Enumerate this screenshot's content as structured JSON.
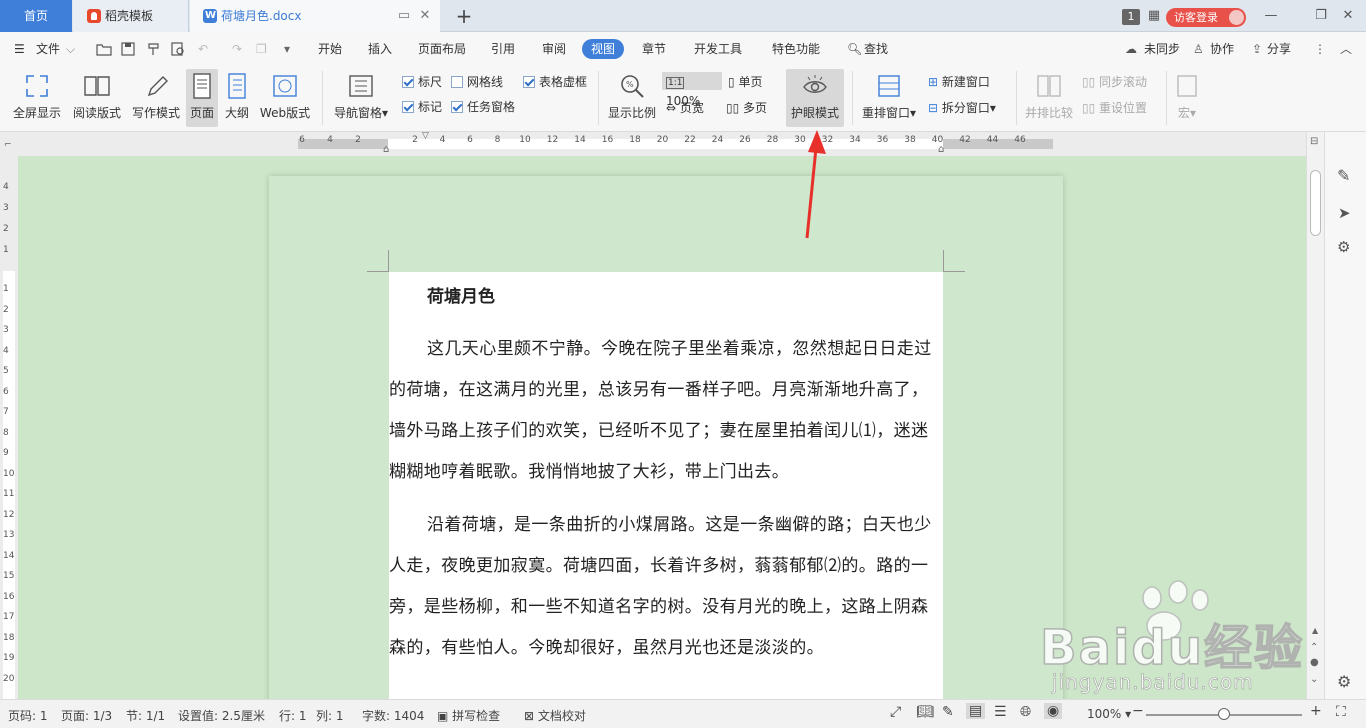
{
  "tabs": {
    "home": "首页",
    "template": "稻壳模板",
    "document": "荷塘月色.docx",
    "new_tab": "+"
  },
  "window": {
    "badge": "1",
    "login": "访客登录"
  },
  "menu": {
    "file": "文件",
    "items": [
      "开始",
      "插入",
      "页面布局",
      "引用",
      "审阅",
      "视图",
      "章节",
      "开发工具",
      "特色功能"
    ],
    "active": "视图",
    "search": "查找",
    "sync": "未同步",
    "collab": "协作",
    "share": "分享"
  },
  "ribbon": {
    "fullscreen": "全屏显示",
    "reading": "阅读版式",
    "writing": "写作模式",
    "page": "页面",
    "outline": "大纲",
    "web": "Web版式",
    "nav_pane": "导航窗格",
    "ruler": "标尺",
    "gridlines": "网格线",
    "table_gridlines": "表格虚框",
    "marks": "标记",
    "task_pane": "任务窗格",
    "zoom_ratio": "显示比例",
    "zoom_value": "100%",
    "page_width": "页宽",
    "single_page": "单页",
    "multi_page": "多页",
    "eye_mode": "护眼模式",
    "arrange": "重排窗口",
    "new_window": "新建窗口",
    "split_window": "拆分窗口",
    "side_by_side": "并排比较",
    "sync_scroll": "同步滚动",
    "reset_position": "重设位置",
    "macro": "宏"
  },
  "ruler": {
    "h": [
      "6",
      "4",
      "2",
      "2",
      "4",
      "6",
      "8",
      "10",
      "12",
      "14",
      "16",
      "18",
      "20",
      "22",
      "24",
      "26",
      "28",
      "30",
      "32",
      "34",
      "36",
      "38",
      "40",
      "42",
      "44",
      "46"
    ],
    "v": [
      "4",
      "3",
      "2",
      "1",
      "1",
      "2",
      "3",
      "4",
      "5",
      "6",
      "7",
      "8",
      "9",
      "10",
      "11",
      "12",
      "13",
      "14",
      "15",
      "16",
      "17",
      "18",
      "19",
      "20"
    ]
  },
  "document": {
    "title": "荷塘月色",
    "paragraphs": [
      "这几天心里颇不宁静。今晚在院子里坐着乘凉，忽然想起日日走过的荷塘，在这满月的光里，总该另有一番样子吧。月亮渐渐地升高了，墙外马路上孩子们的欢笑，已经听不见了；妻在屋里拍着闰儿⑴，迷迷糊糊地哼着眠歌。我悄悄地披了大衫，带上门出去。",
      "沿着荷塘，是一条曲折的小煤屑路。这是一条幽僻的路；白天也少人走，夜晚更加寂寞。荷塘四面，长着许多树，蓊蓊郁郁⑵的。路的一旁，是些杨柳，和一些不知道名字的树。没有月光的晚上，这路上阴森森的，有些怕人。今晚却很好，虽然月光也还是淡淡的。"
    ]
  },
  "status": {
    "page_no": "页码: 1",
    "pages": "页面: 1/3",
    "section": "节: 1/1",
    "setting": "设置值: 2.5厘米",
    "row": "行: 1",
    "col": "列: 1",
    "word_count": "字数: 1404",
    "spell_check": "拼写检查",
    "doc_proof": "文档校对",
    "zoom": "100%",
    "zoom_level": 0.5
  },
  "watermark": {
    "brand": "Baidu经验",
    "url": "jingyan.baidu.com"
  },
  "colors": {
    "accent": "#3f7fd9",
    "eye_bg": "#cde6c9",
    "login": "#e8504a",
    "arrow": "#e8302a"
  }
}
